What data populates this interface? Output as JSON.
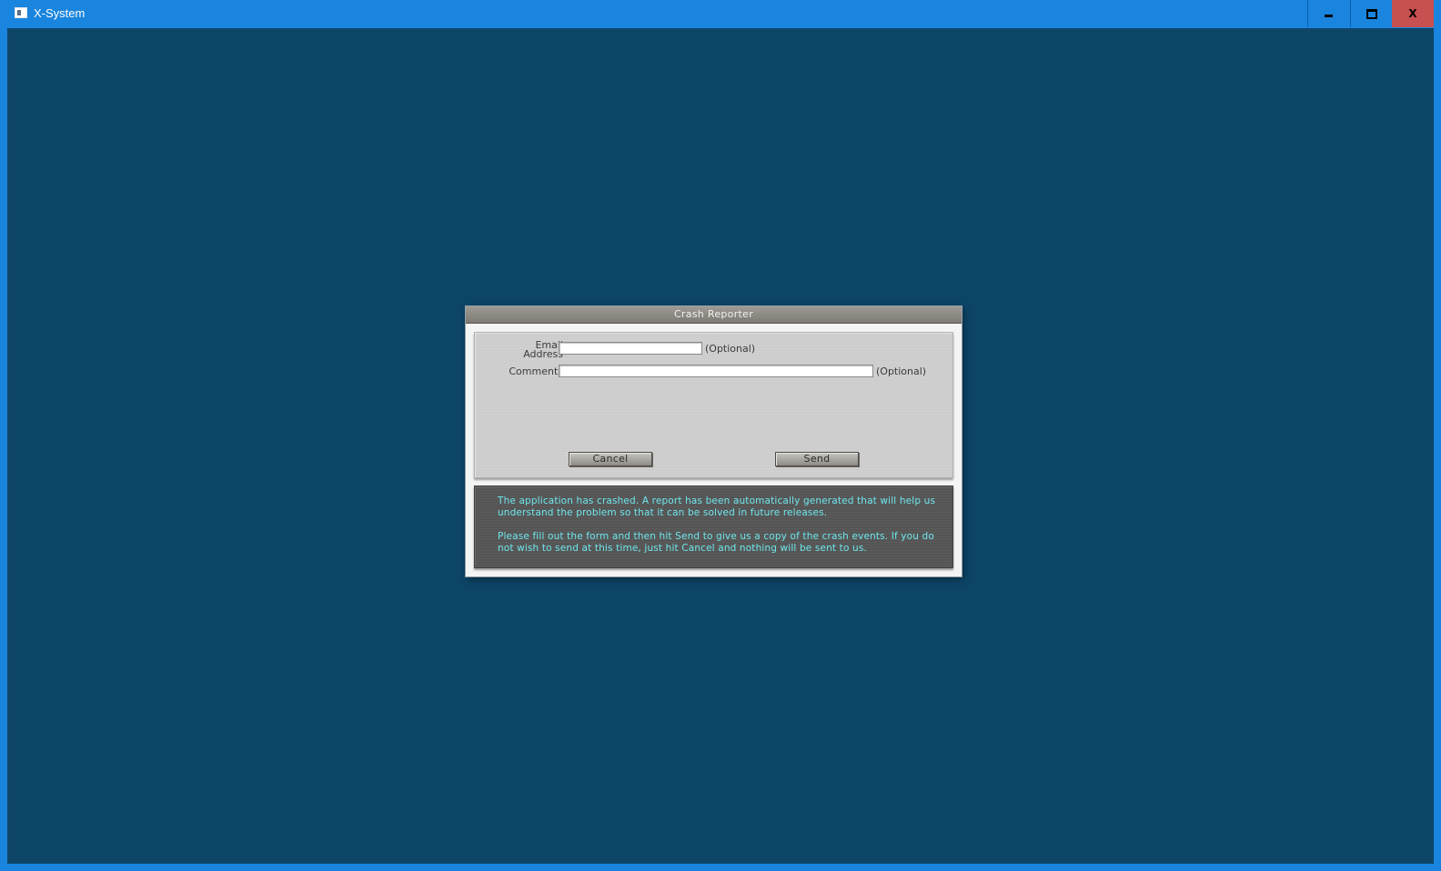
{
  "window": {
    "title": "X-System",
    "controls": {
      "minimize": "minimize-icon",
      "maximize": "maximize-icon",
      "close_label": "X"
    }
  },
  "dialog": {
    "title": "Crash Reporter",
    "form": {
      "email_label_line1": "Email",
      "email_label_line2": "Address",
      "email_value": "",
      "email_optional": "(Optional)",
      "comments_label": "Comments",
      "comments_value": "",
      "comments_optional": "(Optional)",
      "cancel_label": "Cancel",
      "send_label": "Send"
    },
    "info": {
      "paragraph1": "The application has crashed. A report has been automatically generated that will help us understand the problem so that it can be solved in future releases.",
      "paragraph2": "Please fill out the form and then hit Send to give us a copy of the crash events. If you do not wish to send at this time, just hit Cancel and nothing will be sent to us."
    }
  },
  "colors": {
    "titlebar": "#1a85de",
    "client_background": "#0d4567",
    "close_button": "#c75050",
    "info_text": "#6fe6ec"
  }
}
